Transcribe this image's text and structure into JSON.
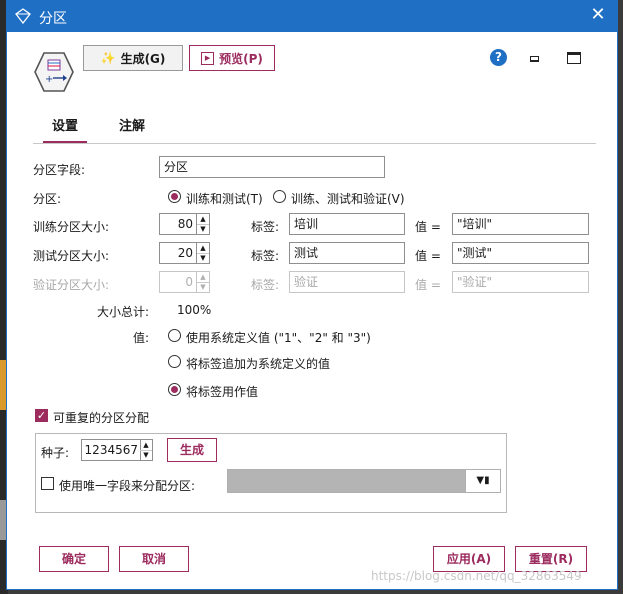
{
  "window": {
    "title": "分区",
    "close_glyph": "✕"
  },
  "toolbar": {
    "generate_label": "生成(G)",
    "preview_label": "预览(P)",
    "help_glyph": "?"
  },
  "tabs": [
    {
      "label": "设置",
      "active": true
    },
    {
      "label": "注解",
      "active": false
    }
  ],
  "settings": {
    "partition_field_label": "分区字段:",
    "partition_field_value": "分区",
    "partition_label": "分区:",
    "mode_options": [
      {
        "label": "训练和测试(T)",
        "selected": true
      },
      {
        "label": "训练、测试和验证(V)",
        "selected": false
      }
    ],
    "rows": [
      {
        "size_label": "训练分区大小:",
        "size": "80",
        "tag_label": "标签:",
        "tag": "培训",
        "value_label": "值 =",
        "value": "\"培训\"",
        "enabled": true
      },
      {
        "size_label": "测试分区大小:",
        "size": "20",
        "tag_label": "标签:",
        "tag": "测试",
        "value_label": "值 =",
        "value": "\"测试\"",
        "enabled": true
      },
      {
        "size_label": "验证分区大小:",
        "size": "0",
        "tag_label": "标签:",
        "tag": "验证",
        "value_label": "值 =",
        "value": "\"验证\"",
        "enabled": false
      }
    ],
    "total_label": "大小总计:",
    "total_value": "100%",
    "values_label": "值:",
    "value_options": [
      {
        "label": "使用系统定义值 (\"1\"、\"2\" 和 \"3\")",
        "selected": false
      },
      {
        "label": "将标签追加为系统定义的值",
        "selected": false
      },
      {
        "label": "将标签用作值",
        "selected": true
      }
    ],
    "repeatable_label": "可重复的分区分配",
    "repeatable_checked": true,
    "seed_label": "种子:",
    "seed_value": "1234567",
    "seed_generate_label": "生成",
    "unique_field_label": "使用唯一字段来分配分区:",
    "unique_field_checked": false
  },
  "buttons": {
    "ok": "确定",
    "cancel": "取消",
    "apply": "应用(A)",
    "reset": "重置(R)"
  },
  "watermark": "https://blog.csdn.net/qq_32863549",
  "colors": {
    "titlebar": "#1f6fc5",
    "accent": "#9c2b5e"
  }
}
